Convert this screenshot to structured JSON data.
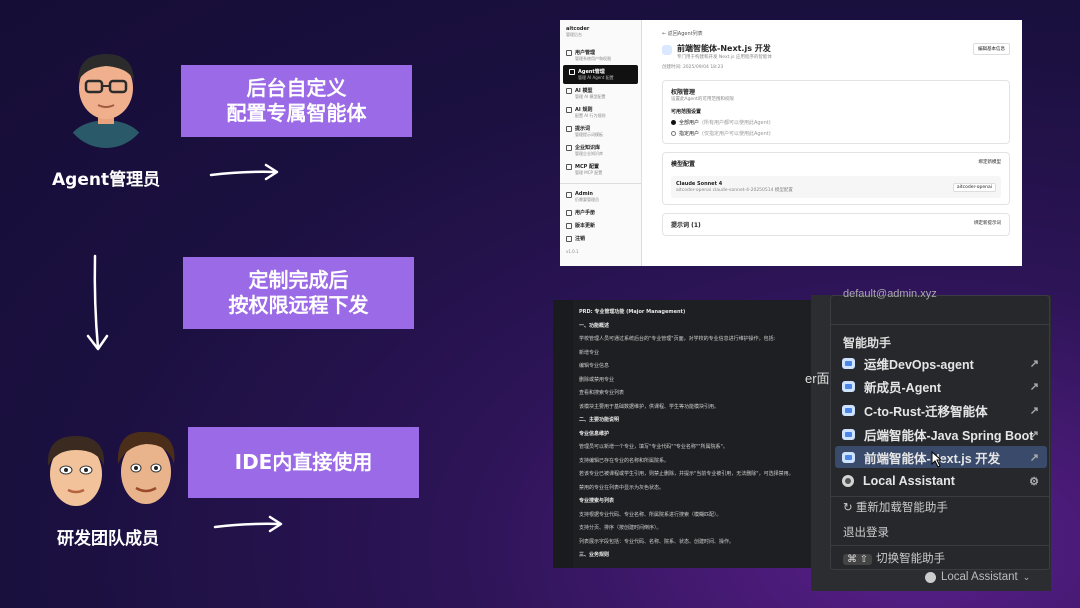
{
  "roles": {
    "admin_label": "Agent管理员",
    "dev_label": "研发团队成员"
  },
  "steps": [
    {
      "line1": "后台自定义",
      "line2": "配置专属智能体"
    },
    {
      "line1": "定制完成后",
      "line2": "按权限远程下发"
    },
    {
      "line1": "IDE内直接使用"
    }
  ],
  "admin_panel": {
    "brand": "aitcoder",
    "brand_sub": "管理后台",
    "sidebar": [
      {
        "title": "用户管理",
        "sub": "管理系统用户和权限"
      },
      {
        "title": "Agent管理",
        "sub": "管理 AI Agent 配置"
      },
      {
        "title": "AI 模型",
        "sub": "管理 AI 模型配置"
      },
      {
        "title": "AI 规则",
        "sub": "配置 AI 行为规则"
      },
      {
        "title": "提示词",
        "sub": "管理提示词模板"
      },
      {
        "title": "企业知识库",
        "sub": "管理企业知识库"
      },
      {
        "title": "MCP 配置",
        "sub": "管理 MCP 配置"
      }
    ],
    "sidebar_bottom": [
      {
        "title": "Admin",
        "sub": "仍需要管理员"
      },
      {
        "title": "用户手册"
      },
      {
        "title": "版本更新"
      },
      {
        "title": "注销"
      }
    ],
    "version": "v1.0.1",
    "back": "返回Agent列表",
    "title": "前端智能体-Next.js 开发",
    "subtitle": "专门用于构建和开发 Next.js 应用程序的智能体",
    "created": "创建时间: 2025/09/04 18:23",
    "edit_button": "编辑基本信息",
    "perm_title": "权限管理",
    "perm_sub": "设置此Agent的可用范围和权限",
    "perm_scope": "可用范围设置",
    "opt_all": "全部用户",
    "opt_all_desc": "(所有用户都可以使用此Agent)",
    "opt_designated": "指定用户",
    "opt_designated_desc": "(仅指定用户可以使用此Agent)",
    "model_title": "模型配置",
    "model_button": "绑定新模型",
    "model_name": "Claude Sonnet 4",
    "model_detail": "aitcoder-openai claude-sonnet-4-20250514 模型配置",
    "model_tag": "aitcoder-openai",
    "prompt_title": "提示词 (1)",
    "prompt_button": "绑定新提示词"
  },
  "ide": {
    "lines": [
      {
        "t": "PRD: 专业管理功能 (Major Management)",
        "h": true
      },
      {
        "t": "一、功能概述",
        "h": true
      },
      {
        "t": "学校管理人员可通过系统后台的\"专业管理\"页面，对学校的专业信息进行维护操作，包括:",
        "h": false
      },
      {
        "t": "新增专业",
        "h": false
      },
      {
        "t": "编辑专业信息",
        "h": false
      },
      {
        "t": "删除或禁用专业",
        "h": false
      },
      {
        "t": "查看和搜索专业列表",
        "h": false
      },
      {
        "t": "该模块主要用于基础数据维护，供课程、学生等功能模块引用。",
        "h": false
      },
      {
        "t": "二、主要功能说明",
        "h": true
      },
      {
        "t": "专业信息维护",
        "h": true
      },
      {
        "t": "管理员可以新增一个专业，填写\"专业代码\"\"专业名称\"\"所属院系\"。",
        "h": false
      },
      {
        "t": "支持编辑已存在专业的名称和所属院系。",
        "h": false
      },
      {
        "t": "若该专业已被课程或学生引用，则禁止删除，并提示\"当前专业被引用，无法删除\"，可选择禁用。",
        "h": false
      },
      {
        "t": "禁用的专业在列表中显示为灰色状态。",
        "h": false
      },
      {
        "t": "专业搜索与列表",
        "h": true
      },
      {
        "t": "支持根据专业代码、专业名称、所属院系进行搜索（模糊匹配）。",
        "h": false
      },
      {
        "t": "支持分页、排序（按创建时间倒序）。",
        "h": false
      },
      {
        "t": "列表展示字段包括：专业代码、名称、院系、状态、创建时间、操作。",
        "h": false
      },
      {
        "t": "三、业务规则",
        "h": true
      }
    ]
  },
  "menu": {
    "email": "default@admin.xyz",
    "header": "智能助手",
    "agents": [
      "运维DevOps-agent",
      "新成员-Agent",
      "C-to-Rust-迁移智能体",
      "后端智能体-Java Spring Boot",
      "前端智能体-Next.js 开发"
    ],
    "local": "Local Assistant",
    "reload": "重新加载智能助手",
    "logout": "退出登录",
    "shortcut_keys": "⌘ ⇧",
    "switch": "切换智能助手",
    "status": "Local Assistant",
    "partial_text": "er面"
  }
}
